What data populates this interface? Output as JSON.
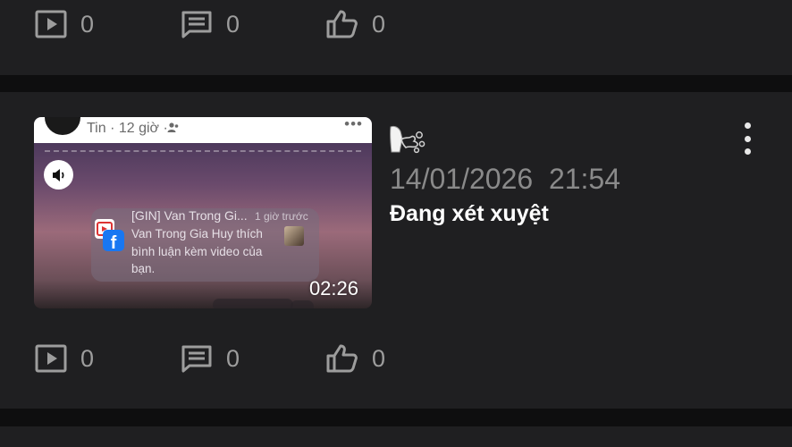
{
  "top_card": {
    "stats": {
      "views": "0",
      "comments": "0",
      "likes": "0"
    }
  },
  "post": {
    "thumbnail": {
      "meta_text": "Tin · 12 giờ ·",
      "menu_text": "•••",
      "notification": {
        "title": "[GIN] Van Trong Gi...",
        "time": "1 giờ trước",
        "body": "Van Trong Gia Huy thích bình luận kèm video của bạn."
      },
      "duration": "02:26"
    },
    "date": "14/01/2026",
    "time": "21:54",
    "title": "Đang xét xuyệt",
    "stats": {
      "views": "0",
      "comments": "0",
      "likes": "0"
    }
  },
  "icons": {
    "views": "play-icon",
    "comments": "comment-icon",
    "likes": "thumbs-up-icon",
    "more": "more-vertical-icon",
    "sound": "speaker-icon"
  },
  "colors": {
    "background": "#0e0e0f",
    "card": "#1f1f21",
    "icon_gray": "#9d9d9d",
    "date_gray": "#8a8a8a",
    "title_white": "#ffffff"
  }
}
